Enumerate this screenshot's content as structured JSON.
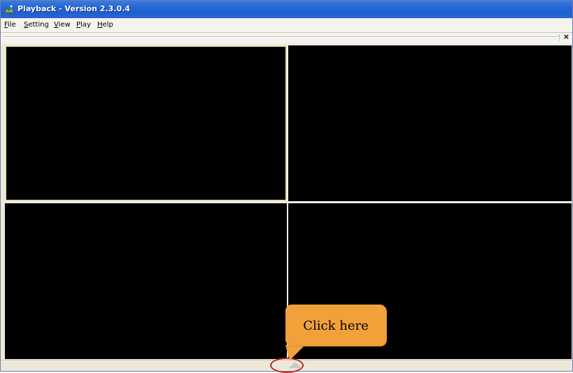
{
  "window": {
    "title": "Playback - Version 2.3.0.4"
  },
  "menu": {
    "items": [
      {
        "mnemonic": "F",
        "rest": "ile"
      },
      {
        "mnemonic": "S",
        "rest": "etting"
      },
      {
        "mnemonic": "V",
        "rest": "iew"
      },
      {
        "mnemonic": "P",
        "rest": "lay"
      },
      {
        "mnemonic": "H",
        "rest": "elp"
      }
    ]
  },
  "toolstrip": {
    "close_glyph": "×"
  },
  "video": {
    "selected_pane": 1,
    "pane_color": "#000000",
    "selected_border_color": "#e8dfae"
  },
  "annotation": {
    "callout_text": "Click here",
    "callout_color": "#f2a13a",
    "highlight_color": "#c0262c"
  },
  "icons": {
    "app": "playback-app-icon",
    "expand": "triangle-up-icon"
  }
}
